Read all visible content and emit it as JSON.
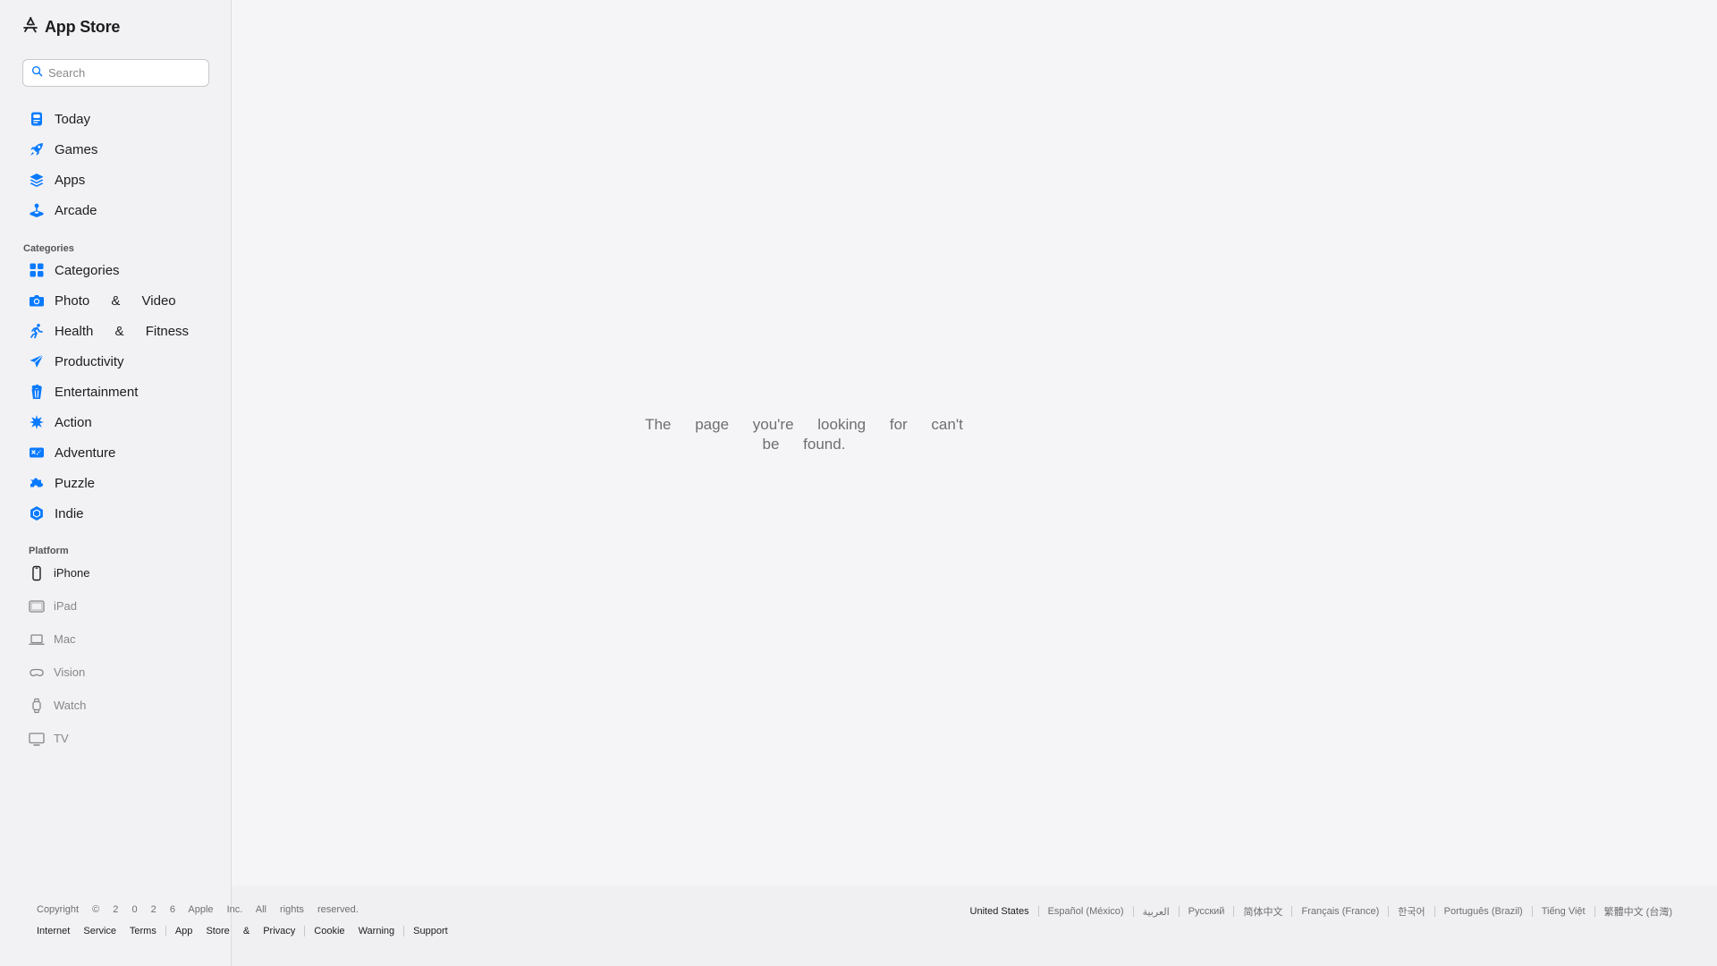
{
  "brand": {
    "name": "App Store",
    "icon": "app-store-icon"
  },
  "search": {
    "placeholder": "Search",
    "value": "",
    "icon": "search-icon"
  },
  "nav": {
    "main_items": [
      {
        "label": "Today",
        "icon": "today-icon"
      },
      {
        "label": "Games",
        "icon": "rocket-icon"
      },
      {
        "label": "Apps",
        "icon": "layers-icon"
      },
      {
        "label": "Arcade",
        "icon": "joystick-icon"
      }
    ],
    "categories_label": "Categories",
    "category_items": [
      {
        "label": "Categories",
        "icon": "grid-icon"
      },
      {
        "label": "Photo & Video",
        "icon": "camera-icon"
      },
      {
        "label": "Health & Fitness",
        "icon": "runner-icon"
      },
      {
        "label": "Productivity",
        "icon": "paper-plane-icon"
      },
      {
        "label": "Entertainment",
        "icon": "popcorn-icon"
      },
      {
        "label": "Action",
        "icon": "burst-icon"
      },
      {
        "label": "Adventure",
        "icon": "map-icon"
      },
      {
        "label": "Puzzle",
        "icon": "puzzle-icon"
      },
      {
        "label": "Indie",
        "icon": "hexagon-icon"
      }
    ],
    "platform_label": "Platform",
    "platform_items": [
      {
        "label": "iPhone",
        "icon": "iphone-icon",
        "active": true
      },
      {
        "label": "iPad",
        "icon": "ipad-icon"
      },
      {
        "label": "Mac",
        "icon": "laptop-icon"
      },
      {
        "label": "Vision",
        "icon": "vision-icon"
      },
      {
        "label": "Watch",
        "icon": "watch-icon"
      },
      {
        "label": "TV",
        "icon": "tv-icon"
      }
    ]
  },
  "main": {
    "message": "The page you're looking for can't be found."
  },
  "footer": {
    "copyright": "Copyright © 2 0 2 6 Apple Inc. All rights reserved.",
    "links": [
      "Internet Service Terms",
      "App Store & Privacy",
      "Cookie Warning",
      "Support"
    ],
    "locales": [
      "United States",
      "Español (México)",
      "العربية",
      "Русский",
      "简体中文",
      "Français (France)",
      "한국어",
      "Português (Brazil)",
      "Tiếng Việt",
      "繁體中文 (台灣)"
    ]
  },
  "colors": {
    "accent": "#0a7aff",
    "background": "#f5f5f7",
    "sidebar": "#f2f2f4"
  }
}
